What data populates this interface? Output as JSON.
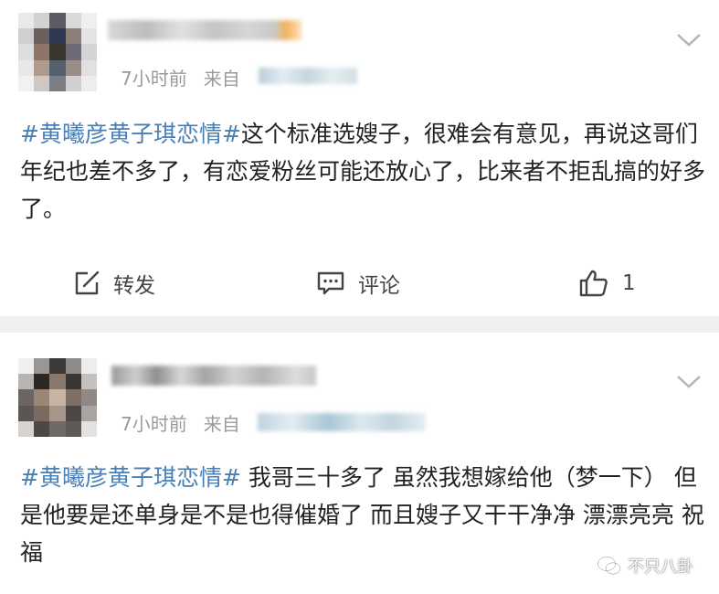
{
  "posts": [
    {
      "time": "7小时前",
      "source_prefix": "来自",
      "hashtag": "#黄曦彦黄子琪恋情#",
      "text": "这个标准选嫂子，很难会有意见，再说这哥们年纪也差不多了，有恋爱粉丝可能还放心了，比来者不拒乱搞的好多了。",
      "actions": {
        "repost_label": "转发",
        "comment_label": "评论",
        "like_count": "1"
      }
    },
    {
      "time": "7小时前",
      "source_prefix": "来自",
      "hashtag": "#黄曦彦黄子琪恋情#",
      "text": " 我哥三十多了 虽然我想嫁给他（梦一下） 但是他要是还单身是不是也得催婚了 而且嫂子又干干净净 漂漂亮亮 祝福"
    }
  ],
  "watermark": "不只八卦",
  "colors": {
    "hashtag": "#4a7fb5",
    "meta": "#9a9a9a",
    "separator": "#f0f0f0"
  },
  "icons": [
    "chevron-down-icon",
    "repost-icon",
    "comment-icon",
    "like-icon",
    "wechat-icon"
  ]
}
